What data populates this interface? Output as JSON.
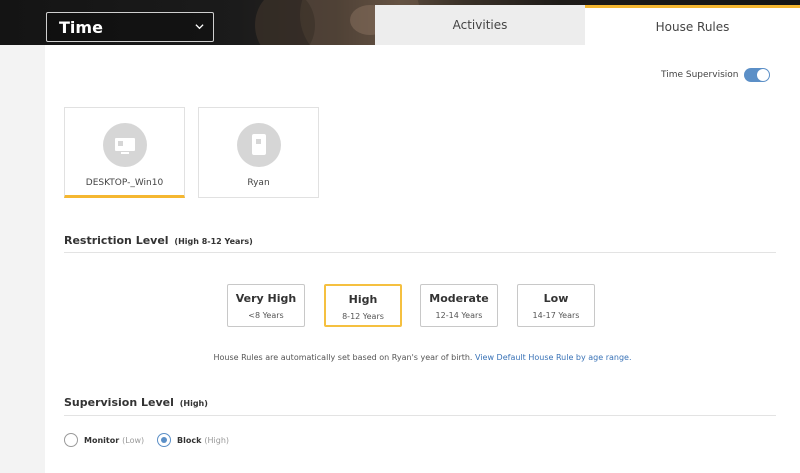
{
  "header": {
    "category_select": "Time",
    "tabs": [
      {
        "label": "Activities",
        "active": false
      },
      {
        "label": "House Rules",
        "active": true
      }
    ]
  },
  "supervision": {
    "toggle_label": "Time Supervision",
    "toggle_on": true
  },
  "devices": [
    {
      "name": "DESKTOP-_Win10",
      "icon": "desktop-icon",
      "selected": true
    },
    {
      "name": "Ryan",
      "icon": "tablet-icon",
      "selected": false
    }
  ],
  "restriction": {
    "title": "Restriction Level",
    "current": "(High 8-12 Years)",
    "levels": [
      {
        "label": "Very High",
        "range": "<8 Years",
        "active": false
      },
      {
        "label": "High",
        "range": "8-12 Years",
        "active": true
      },
      {
        "label": "Moderate",
        "range": "12-14 Years",
        "active": false
      },
      {
        "label": "Low",
        "range": "14-17 Years",
        "active": false
      }
    ],
    "note_text": "House Rules are automatically set based on Ryan's year of birth.",
    "note_link": "View Default House Rule by age range."
  },
  "supervision_level": {
    "title": "Supervision Level",
    "current": "(High)",
    "options": [
      {
        "label": "Monitor",
        "sub": "(Low)",
        "checked": false
      },
      {
        "label": "Block",
        "sub": "(High)",
        "checked": true
      }
    ]
  },
  "colors": {
    "accent": "#f5b731",
    "toggle": "#5b8fc7",
    "link": "#3a73b7"
  }
}
